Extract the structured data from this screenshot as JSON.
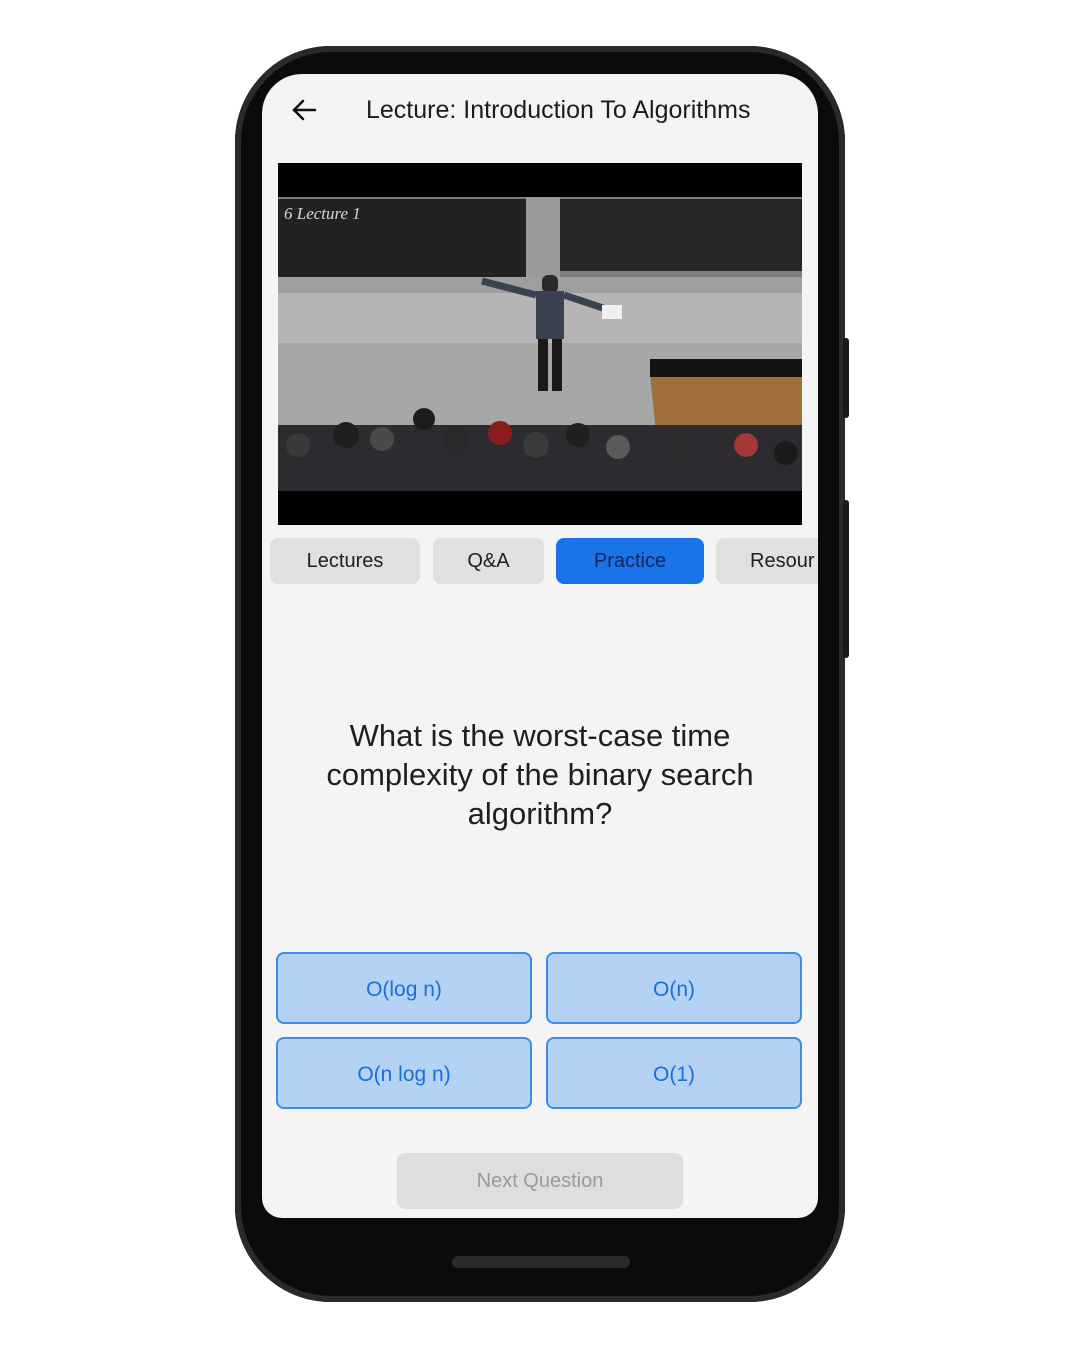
{
  "appbar": {
    "back_icon": "arrow-left-icon",
    "title": "Lecture: Introduction To Algorithms"
  },
  "video": {
    "board_text": "6 Lecture 1"
  },
  "tabs": [
    {
      "label": "Lectures",
      "active": false
    },
    {
      "label": "Q&A",
      "active": false
    },
    {
      "label": "Practice",
      "active": true
    },
    {
      "label": "Resour",
      "active": false
    }
  ],
  "quiz": {
    "question": "What is the worst-case time complexity of the binary search algorithm?",
    "answers": [
      "O(log n)",
      "O(n)",
      "O(n log n)",
      "O(1)"
    ],
    "next_label": "Next Question"
  },
  "colors": {
    "accent": "#1a73e8",
    "answer_fill": "#b4d2f4",
    "answer_text": "#1a6fd6"
  }
}
